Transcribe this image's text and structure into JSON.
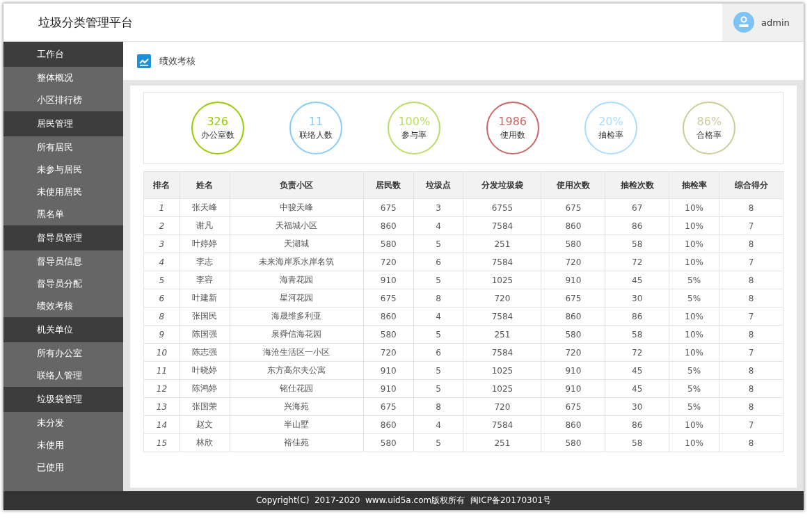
{
  "header": {
    "title": "垃圾分类管理平台",
    "user": "admin"
  },
  "sidebar": {
    "groups": [
      {
        "label": "工作台",
        "items": [
          "整体概况",
          "小区排行榜"
        ]
      },
      {
        "label": "居民管理",
        "items": [
          "所有居民",
          "未参与居民",
          "未使用居民",
          "黑名单"
        ]
      },
      {
        "label": "督导员管理",
        "items": [
          "督导员信息",
          "督导员分配",
          "绩效考核"
        ]
      },
      {
        "label": "机关单位",
        "items": [
          "所有办公室",
          "联络人管理"
        ]
      },
      {
        "label": "垃圾袋管理",
        "items": [
          "未分发",
          "未使用",
          "已使用"
        ]
      }
    ]
  },
  "page_title": "绩效考核",
  "stats": [
    {
      "value": "326",
      "label": "办公室数",
      "color": "#99cc00"
    },
    {
      "value": "11",
      "label": "联络人数",
      "color": "#88ccf8"
    },
    {
      "value": "100%",
      "label": "参与率",
      "color": "#bbdd66"
    },
    {
      "value": "1986",
      "label": "使用数",
      "color": "#cc6666"
    },
    {
      "value": "20%",
      "label": "抽检率",
      "color": "#aaddff"
    },
    {
      "value": "86%",
      "label": "合格率",
      "color": "#cccc99"
    }
  ],
  "table": {
    "columns": [
      "排名",
      "姓名",
      "负责小区",
      "居民数",
      "垃圾点",
      "分发垃圾袋",
      "使用次数",
      "抽检次数",
      "抽检率",
      "综合得分"
    ],
    "rows": [
      [
        "1",
        "张天峰",
        "中骏天峰",
        "675",
        "3",
        "6755",
        "675",
        "67",
        "10%",
        "8"
      ],
      [
        "2",
        "谢凡",
        "天福城小区",
        "860",
        "4",
        "7584",
        "860",
        "86",
        "10%",
        "7"
      ],
      [
        "3",
        "叶婷婷",
        "天湖城",
        "580",
        "5",
        "251",
        "580",
        "58",
        "10%",
        "8"
      ],
      [
        "4",
        "李志",
        "未来海岸系水岸名筑",
        "720",
        "6",
        "7584",
        "720",
        "72",
        "10%",
        "7"
      ],
      [
        "5",
        "李容",
        "海青花园",
        "910",
        "5",
        "1025",
        "910",
        "45",
        "5%",
        "8"
      ],
      [
        "6",
        "叶建新",
        "星河花园",
        "675",
        "8",
        "720",
        "675",
        "30",
        "5%",
        "8"
      ],
      [
        "8",
        "张国民",
        "海晟维多利亚",
        "860",
        "4",
        "7584",
        "860",
        "86",
        "10%",
        "7"
      ],
      [
        "9",
        "陈国强",
        "泉舜信海花园",
        "580",
        "5",
        "251",
        "580",
        "58",
        "10%",
        "8"
      ],
      [
        "10",
        "陈志强",
        "海沧生活区一小区",
        "720",
        "6",
        "7584",
        "720",
        "72",
        "10%",
        "7"
      ],
      [
        "11",
        "叶晓婷",
        "东方高尔夫公寓",
        "910",
        "5",
        "1025",
        "910",
        "45",
        "5%",
        "8"
      ],
      [
        "12",
        "陈鸿婷",
        "铭仕花园",
        "910",
        "5",
        "1025",
        "910",
        "45",
        "5%",
        "8"
      ],
      [
        "13",
        "张国荣",
        "兴海苑",
        "675",
        "8",
        "720",
        "675",
        "30",
        "5%",
        "8"
      ],
      [
        "14",
        "赵文",
        "半山墅",
        "860",
        "4",
        "7584",
        "860",
        "86",
        "10%",
        "7"
      ],
      [
        "15",
        "林欣",
        "裕佳苑",
        "580",
        "5",
        "251",
        "580",
        "58",
        "10%",
        "8"
      ]
    ]
  },
  "footer": "Copyright(C)  2017-2020  www.uid5a.com版权所有  闽ICP备20170301号"
}
